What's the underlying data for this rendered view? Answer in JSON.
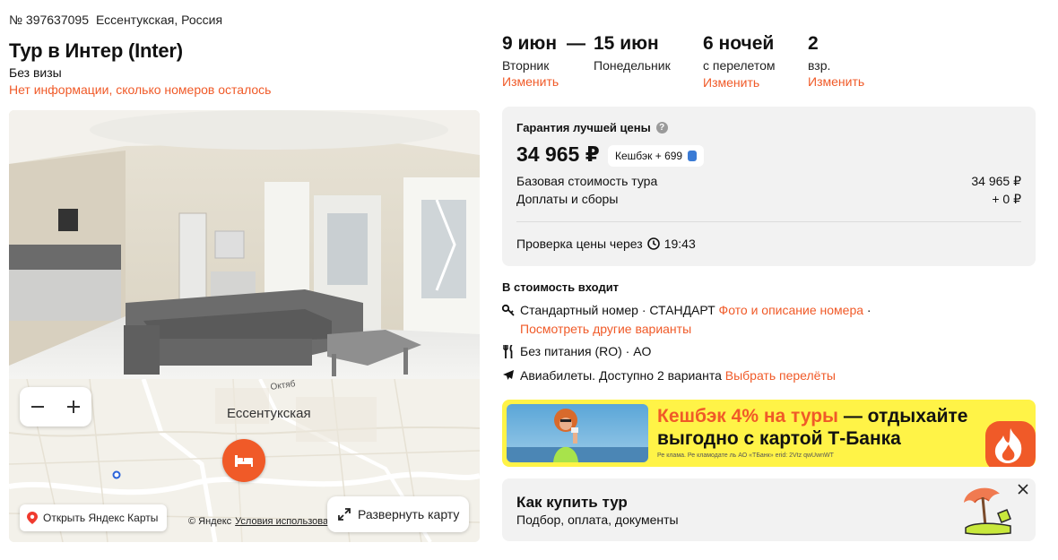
{
  "header": {
    "order_number": "№ 397637095",
    "location": "Ессентукская, Россия",
    "title": "Тур в Интер (Inter)",
    "visa": "Без визы",
    "rooms_info": "Нет информации, сколько номеров осталось"
  },
  "map": {
    "city": "Ессентукская",
    "street_fragment": "Октяб",
    "open_yandex": "Открыть Яндекс Карты",
    "copyright": "© Яндекс",
    "terms": "Условия использова",
    "expand": "Развернуть карту"
  },
  "dates": {
    "start_date": "9 июн",
    "dash": "—",
    "end_date": "15 июн",
    "start_day": "Вторник",
    "end_day": "Понедельник",
    "change_dates": "Изменить",
    "nights": "6 ночей",
    "nights_sub": "с перелетом",
    "change_nights": "Изменить",
    "adults": "2",
    "adults_sub": "взр.",
    "change_adults": "Изменить"
  },
  "price": {
    "guarantee": "Гарантия лучшей цены",
    "total": "34 965 ₽",
    "cashback": "Кешбэк + 699",
    "base_label": "Базовая стоимость тура",
    "base_value": "34 965 ₽",
    "fees_label": "Доплаты и сборы",
    "fees_value": "+ 0 ₽",
    "check_label": "Проверка цены через",
    "check_time": "19:43"
  },
  "includes": {
    "title": "В стоимость входит",
    "room_text": "Стандартный номер · СТАНДАРТ",
    "room_link": "Фото и описание номера",
    "room_sep": " ·",
    "other_variants": "Посмотреть другие варианты",
    "meal": "Без питания (RO) · AO",
    "flights_text": "Авиабилеты. Доступно 2 варианта",
    "flights_link": "Выбрать перелёты"
  },
  "banner": {
    "highlight": "Кешбэк 4% на туры",
    "rest_1": " — отдыхайте",
    "rest_2": "выгодно с картой Т-Банка",
    "fine_print": "Ре клама. Ре кламодате ль АО «ТБанк» erid: 2Vtz qwUwnWT"
  },
  "howto": {
    "title": "Как купить тур",
    "subtitle": "Подбор, оплата, документы"
  },
  "colors": {
    "accent": "#f05a28",
    "card_bg": "#f2f2f2",
    "banner_bg": "#fff347",
    "tbank_blue": "#3a7bd5"
  },
  "icons": {
    "help": "question-icon",
    "clock": "clock-icon",
    "key": "key-icon",
    "food": "fork-knife-icon",
    "plane": "plane-icon",
    "bed": "bed-icon",
    "pin": "location-pin-icon",
    "expand": "expand-icon",
    "close": "close-icon",
    "next": "chevron-right-icon"
  }
}
